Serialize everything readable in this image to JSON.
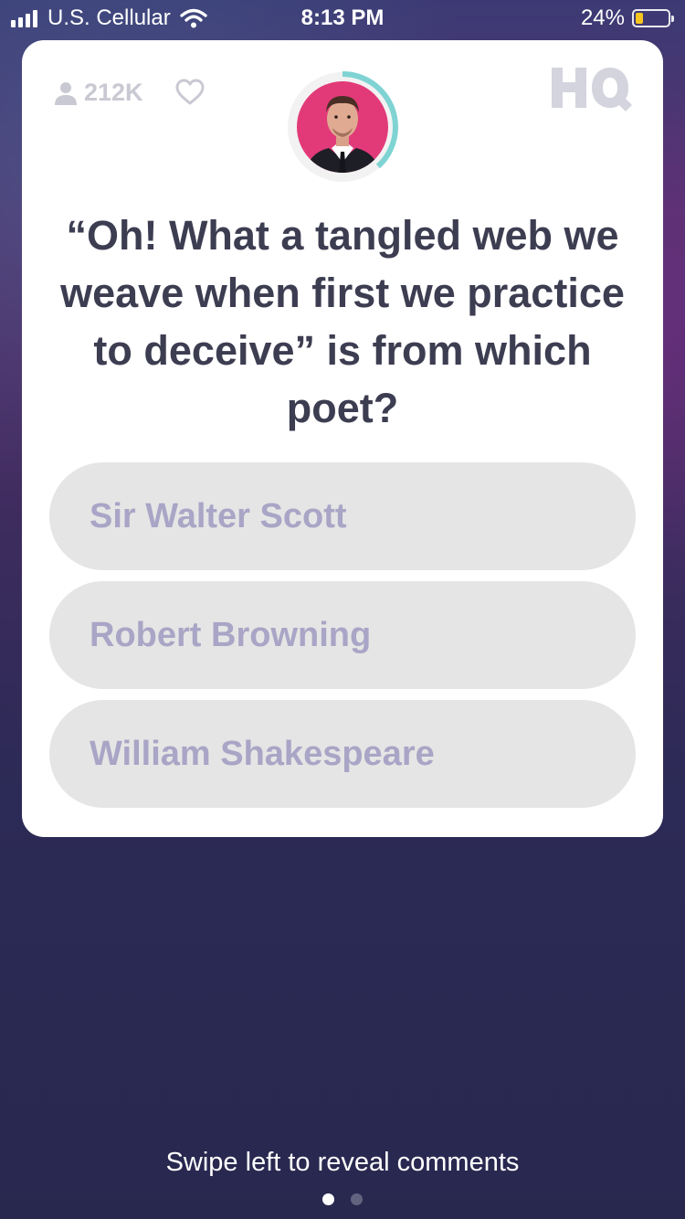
{
  "status_bar": {
    "carrier": "U.S. Cellular",
    "time": "8:13 PM",
    "battery_percent": "24%",
    "battery_level": 0.24,
    "battery_color": "#f7c51f",
    "signal_bars": 4,
    "icons": [
      "signal-icon",
      "wifi-icon",
      "battery-icon"
    ]
  },
  "card": {
    "viewer_count": "212K",
    "viewer_icon": "person-icon",
    "like_icon": "heart-icon",
    "logo_text": "HQ",
    "host_avatar": "host-avatar",
    "timer_color": "#7fd3d3",
    "question": "“Oh! What a tangled web we weave when first we practice to deceive” is from which poet?",
    "answers": [
      "Sir Walter Scott",
      "Robert Browning",
      "William Shakespeare"
    ]
  },
  "footer": {
    "hint": "Swipe left to reveal comments",
    "page_count": 2,
    "active_page": 1
  }
}
